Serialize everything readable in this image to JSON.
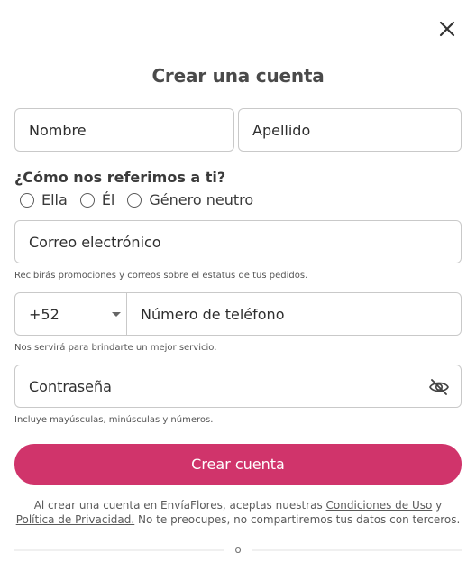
{
  "dialog": {
    "title": "Crear una cuenta",
    "close_icon": "close-icon"
  },
  "form": {
    "first_name": {
      "placeholder": "Nombre",
      "value": ""
    },
    "last_name": {
      "placeholder": "Apellido",
      "value": ""
    },
    "pronoun_question": "¿Cómo nos referimos a ti?",
    "pronoun_options": [
      "Ella",
      "Él",
      "Género neutro"
    ],
    "email": {
      "placeholder": "Correo electrónico",
      "value": "",
      "helper": "Recibirás promociones y correos sobre el estatus de tus pedidos."
    },
    "phone": {
      "country_code": "+52",
      "placeholder": "Número de teléfono",
      "value": "",
      "helper": "Nos servirá para brindarte un mejor servicio."
    },
    "password": {
      "placeholder": "Contraseña",
      "value": "",
      "helper": "Incluye mayúsculas, minúsculas y números.",
      "toggle_icon": "eye-off-icon"
    },
    "submit_label": "Crear cuenta"
  },
  "terms": {
    "prefix": "Al crear una cuenta en EnvíaFlores, aceptas nuestras",
    "terms_link": "Condiciones de Uso",
    "and": "y",
    "privacy_link": "Política de Privacidad.",
    "suffix": "No te preocupes, no compartiremos tus datos con terceros."
  },
  "divider_text": "o",
  "colors": {
    "accent": "#d0346b",
    "border": "#c9c9c9"
  }
}
